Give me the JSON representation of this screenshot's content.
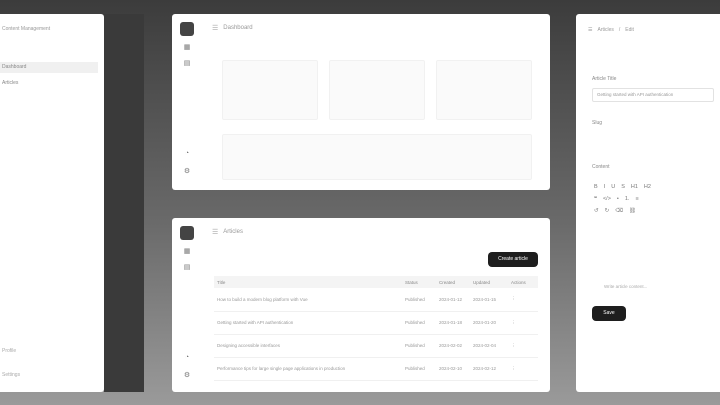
{
  "left_panel": {
    "title": "Content Management",
    "nav_items": [
      {
        "label": "Dashboard",
        "active": true
      },
      {
        "label": "Articles",
        "active": false
      }
    ],
    "bottom_items": [
      "Profile",
      "Settings"
    ]
  },
  "dashboard_panel": {
    "header_title": "Dashboard",
    "stat_cards": [
      "",
      "",
      ""
    ]
  },
  "articles_panel": {
    "header_title": "Articles",
    "create_button": "Create article",
    "columns": [
      "Title",
      "Status",
      "Created",
      "Updated",
      "Actions"
    ],
    "rows": [
      {
        "title": "How to build a modern blog platform with Vue",
        "status": "Published",
        "created": "2024-01-12",
        "updated": "2024-01-15",
        "action": "⋮"
      },
      {
        "title": "Getting started with API authentication",
        "status": "Published",
        "created": "2024-01-18",
        "updated": "2024-01-20",
        "action": "⋮"
      },
      {
        "title": "Designing accessible interfaces",
        "status": "Published",
        "created": "2024-02-02",
        "updated": "2024-02-04",
        "action": "⋮"
      },
      {
        "title": "Performance tips for large single page applications in production",
        "status": "Published",
        "created": "2024-02-10",
        "updated": "2024-02-12",
        "action": "⋮"
      }
    ]
  },
  "editor_panel": {
    "breadcrumb": [
      "Articles",
      "Edit"
    ],
    "title_label": "Article Title",
    "title_value": "Getting started with API authentication",
    "slug_label": "Slug",
    "content_label": "Content",
    "toolbar_rows": [
      [
        "B",
        "I",
        "U",
        "S",
        "H1",
        "H2"
      ],
      [
        "❝",
        "</>",
        "•",
        "1.",
        "≡"
      ],
      [
        "↺",
        "↻",
        "⌫",
        "⛓"
      ]
    ],
    "placeholder": "Write article content...",
    "save_button": "Save"
  }
}
